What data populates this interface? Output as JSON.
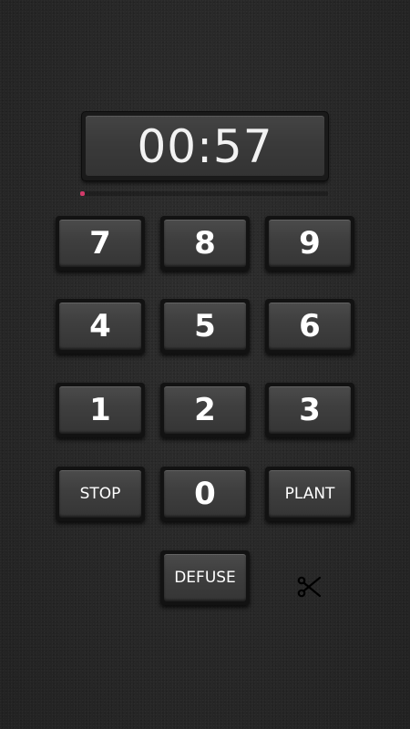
{
  "display": {
    "time": "00:57"
  },
  "progress": {
    "fraction": 0.02,
    "color": "#d23a6a"
  },
  "keypad": {
    "row1": [
      "7",
      "8",
      "9"
    ],
    "row2": [
      "4",
      "5",
      "6"
    ],
    "row3": [
      "1",
      "2",
      "3"
    ],
    "row4": [
      "STOP",
      "0",
      "PLANT"
    ],
    "row5": [
      "DEFUSE"
    ]
  },
  "icons": {
    "cut": "scissors-icon"
  }
}
